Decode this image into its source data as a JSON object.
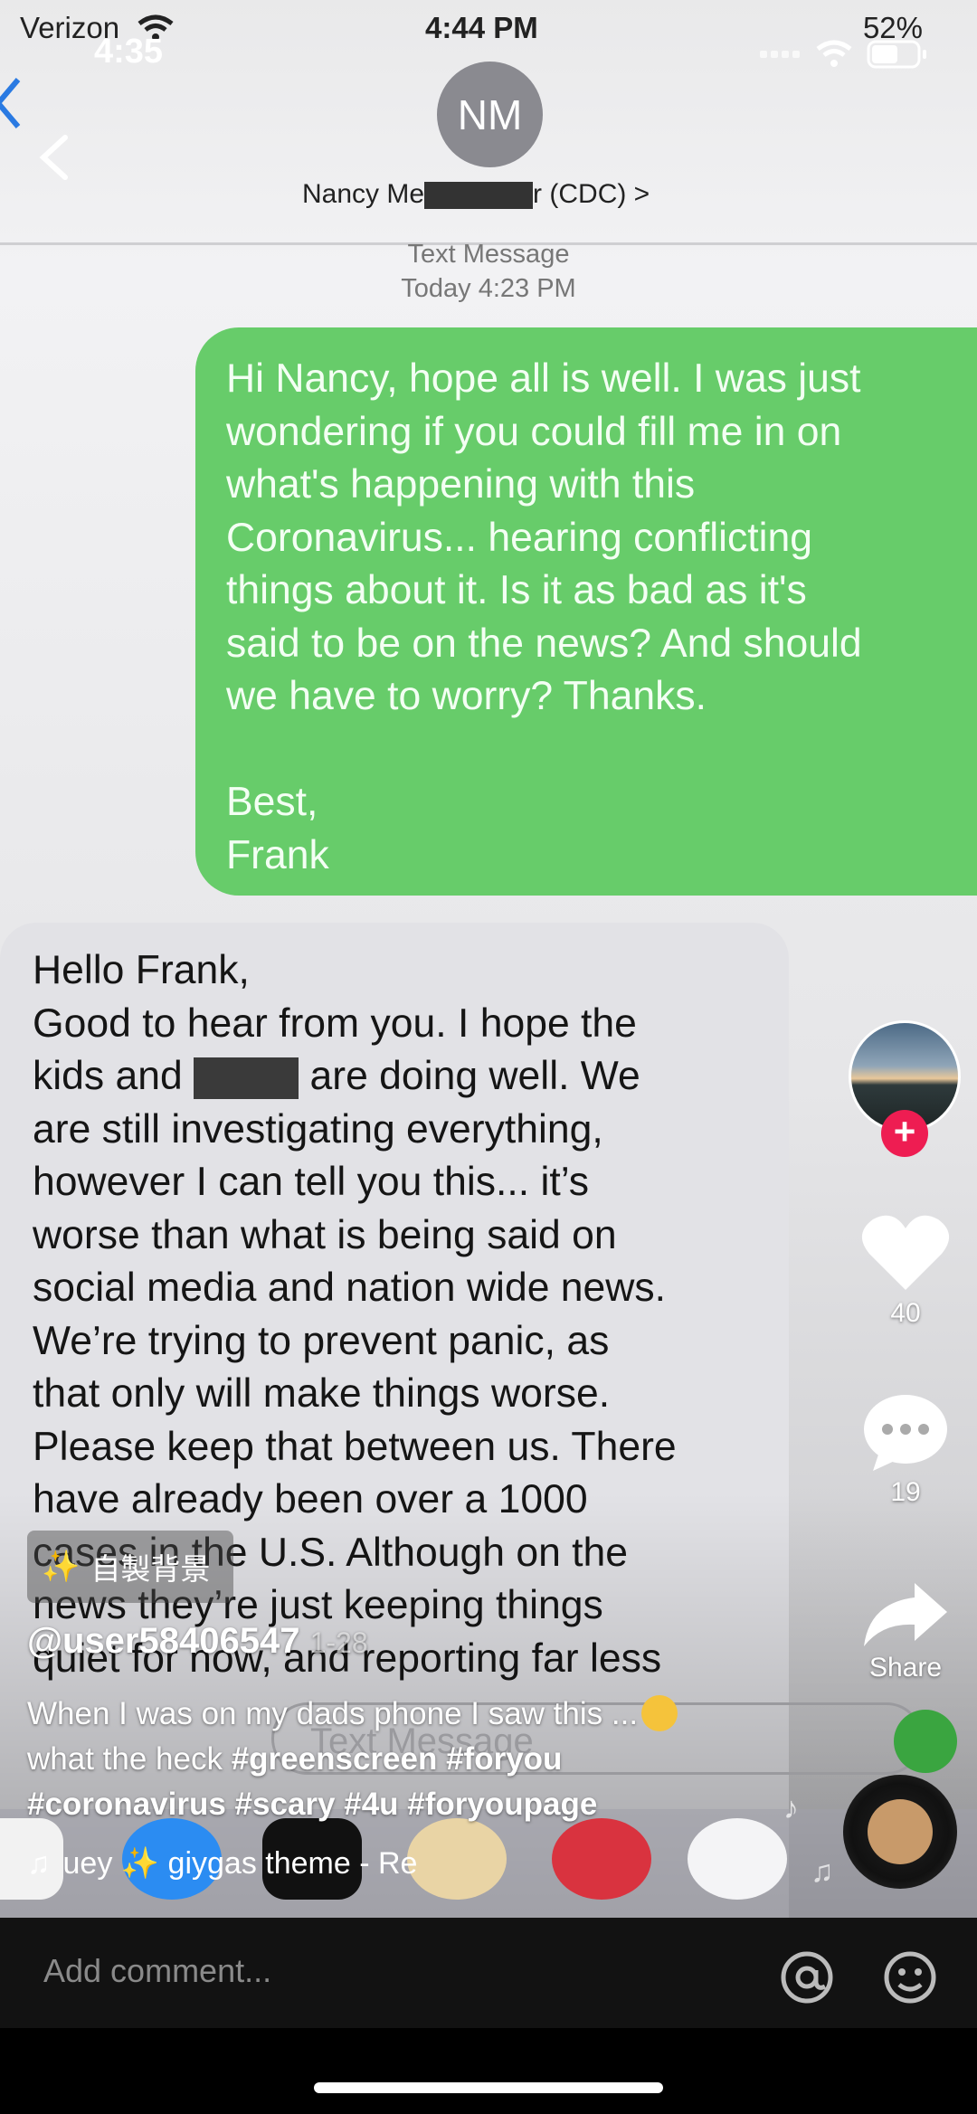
{
  "tiktok": {
    "status_time": "4:35",
    "back_icon": "chevron-left-icon",
    "likes": "40",
    "comments": "19",
    "share_label": "Share",
    "effect_tag": "自製背景",
    "username": "@user58406547",
    "posted_ago": "1-28",
    "caption_text": "When I was on my dads phone I saw this ...",
    "caption_tags_line1": "what the heck",
    "hashtags": [
      "#greenscreen",
      "#foryou",
      "#coronavirus",
      "#scary",
      "#4u",
      "#foryoupage"
    ],
    "music_text": "uey ✨ giygas theme - Re",
    "comment_placeholder": "Add comment...",
    "colors": {
      "accent": "#ee1d52",
      "comment_bar": "#121212"
    }
  },
  "imessage": {
    "carrier": "Verizon",
    "time": "4:44 PM",
    "battery": "52%",
    "contact_initials": "NM",
    "contact_name_start": "Nancy Me",
    "contact_name_end": "r (CDC) >",
    "meta_line1": "Text Message",
    "meta_line2": "Today 4:23 PM",
    "outgoing": "Hi Nancy, hope all is well. I was just\nwondering if you could fill me in on\nwhat's happening with this\nCoronavirus... hearing conflicting\nthings about it. Is it as bad as it's\nsaid to be on the news? And should\nwe have to worry? Thanks.\n\nBest,\nFrank",
    "incoming_line1": "Hello Frank,",
    "incoming_line2a": "Good to hear from you. I hope the",
    "incoming_line3a": "kids and",
    "incoming_line3b": "are doing well. We",
    "incoming_rest": [
      "are still investigating everything,",
      "however I can tell you this... it’s",
      "worse than what is being said on",
      "social media and nation wide news.",
      "We’re trying to prevent panic, as",
      "that only will make things worse.",
      "Please keep that between us. There",
      "have already been over a 1000",
      "cases in the U.S. Although on the",
      "news they’re just keeping things",
      "quiet for now, and reporting far less"
    ],
    "input_placeholder": "Text Message"
  }
}
